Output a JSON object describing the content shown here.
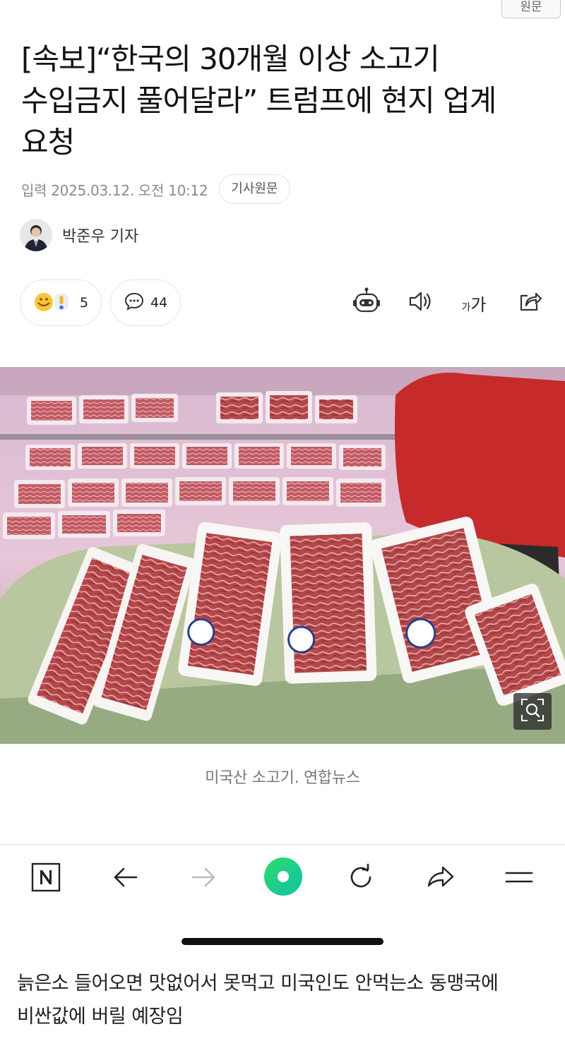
{
  "top_chip": {
    "label": "원문"
  },
  "article": {
    "headline": "[속보]“한국의 30개월 이상 소고기 수입금지 풀어달라” 트럼프에 현지 업계 요청",
    "date": "입력 2025.03.12. 오전 10:12",
    "source_button": "기사원문",
    "reporter": "박준우 기자",
    "reaction_count": "5",
    "comment_count": "44",
    "font_size_label_small": "가",
    "font_size_label_large": "가",
    "photo_caption": "미국산 소고기. 연합뉴스"
  },
  "icons": {
    "reaction": "reaction-emoji-icon",
    "comment": "comment-bubble-icon",
    "summary": "robot-icon",
    "tts": "speaker-icon",
    "share": "share-icon",
    "zoom": "zoom-icon",
    "nav": [
      "naver-home-icon",
      "back-arrow-icon",
      "forward-arrow-icon",
      "green-dot-icon",
      "refresh-icon",
      "share-arrow-icon",
      "menu-icon"
    ]
  },
  "colors": {
    "accent_green": "#16c785",
    "text_primary": "#111111",
    "text_secondary": "#8a8a8a"
  },
  "user_comment": "늙은소 들어오면 맛없어서 못먹고 미국인도 안먹는소 동맹국에 비싼값에 버릴 예장임"
}
